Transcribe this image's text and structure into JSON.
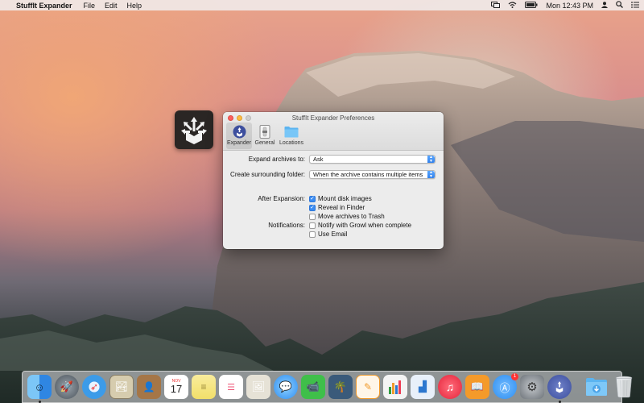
{
  "menubar": {
    "app_name": "StuffIt Expander",
    "menus": [
      "File",
      "Edit",
      "Help"
    ],
    "clock": "Mon 12:43 PM",
    "icons": [
      "display-mirror-icon",
      "wifi-icon",
      "battery-icon",
      "user-icon",
      "spotlight-icon",
      "notification-center-icon"
    ]
  },
  "window": {
    "title": "StuffIt Expander Preferences",
    "tabs": [
      {
        "label": "Expander",
        "icon": "expander-icon",
        "active": true
      },
      {
        "label": "General",
        "icon": "general-icon",
        "active": false
      },
      {
        "label": "Locations",
        "icon": "folder-icon",
        "active": false
      }
    ],
    "expand_archives_label": "Expand archives to:",
    "expand_archives_value": "Ask",
    "surrounding_folder_label": "Create surrounding folder:",
    "surrounding_folder_value": "When the archive contains multiple items",
    "after_expansion_label": "After Expansion:",
    "notifications_label": "Notifications:",
    "checkboxes": [
      {
        "label": "Mount disk images",
        "checked": true
      },
      {
        "label": "Reveal in Finder",
        "checked": true
      },
      {
        "label": "Move archives to Trash",
        "checked": false
      },
      {
        "label": "Notify with Growl when complete",
        "checked": false
      },
      {
        "label": "Use Email",
        "checked": false
      }
    ]
  },
  "dock": {
    "calendar_month": "NOV",
    "calendar_day": "17",
    "app_store_badge": "1",
    "items": [
      {
        "name": "finder",
        "color": "#4aa3f0"
      },
      {
        "name": "launchpad",
        "color": "#5c6670"
      },
      {
        "name": "safari",
        "color": "#3c9be8"
      },
      {
        "name": "photo-app",
        "color": "#c9c2a8"
      },
      {
        "name": "contacts",
        "color": "#b08552"
      },
      {
        "name": "calendar",
        "color": "#ffffff"
      },
      {
        "name": "notes",
        "color": "#f7e892"
      },
      {
        "name": "reminders",
        "color": "#ffffff"
      },
      {
        "name": "preview",
        "color": "#d8d4c8"
      },
      {
        "name": "messages",
        "color": "#5ab2f5"
      },
      {
        "name": "facetime",
        "color": "#3fbf4a"
      },
      {
        "name": "iphoto",
        "color": "#4b6b8a"
      },
      {
        "name": "pages",
        "color": "#f09a2c"
      },
      {
        "name": "numbers",
        "color": "#2f9b3f"
      },
      {
        "name": "keynote",
        "color": "#2c77cf"
      },
      {
        "name": "itunes",
        "color": "#ee3e55"
      },
      {
        "name": "ibooks",
        "color": "#f49a2a"
      },
      {
        "name": "app-store",
        "color": "#2f8ef0"
      },
      {
        "name": "system-preferences",
        "color": "#8a8f96"
      },
      {
        "name": "stuffit-expander",
        "color": "#4a5ea8"
      }
    ]
  }
}
